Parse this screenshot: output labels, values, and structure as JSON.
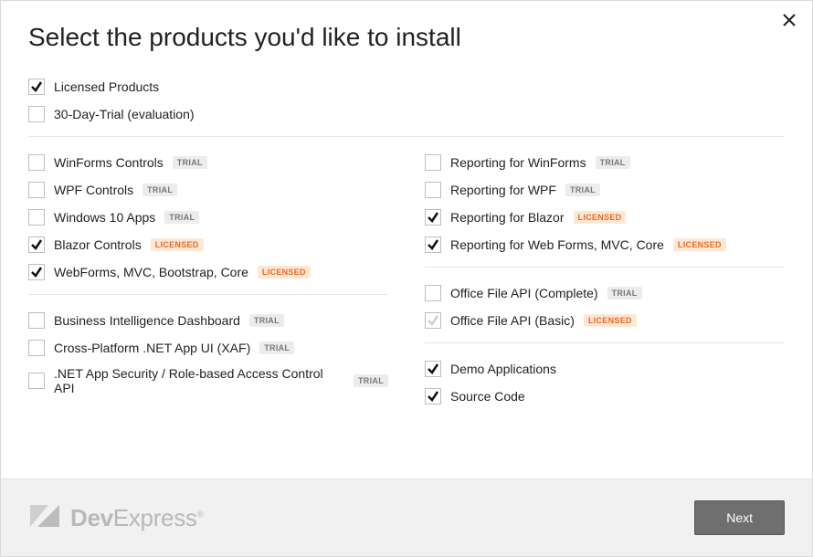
{
  "title": "Select the products you'd like to install",
  "topOptions": [
    {
      "id": "licensed-products",
      "label": "Licensed Products",
      "checked": true
    },
    {
      "id": "trial-30-day",
      "label": "30-Day-Trial (evaluation)",
      "checked": false
    }
  ],
  "badges": {
    "trial": "TRIAL",
    "licensed": "LICENSED"
  },
  "leftGroups": [
    [
      {
        "id": "winforms-controls",
        "label": "WinForms Controls",
        "badge": "trial",
        "checked": false
      },
      {
        "id": "wpf-controls",
        "label": "WPF Controls",
        "badge": "trial",
        "checked": false
      },
      {
        "id": "win10-apps",
        "label": "Windows 10 Apps",
        "badge": "trial",
        "checked": false
      },
      {
        "id": "blazor-controls",
        "label": "Blazor Controls",
        "badge": "licensed",
        "checked": true
      },
      {
        "id": "webforms-mvc",
        "label": "WebForms, MVC, Bootstrap, Core",
        "badge": "licensed",
        "checked": true
      }
    ],
    [
      {
        "id": "bi-dashboard",
        "label": "Business Intelligence Dashboard",
        "badge": "trial",
        "checked": false
      },
      {
        "id": "xaf",
        "label": "Cross-Platform .NET App UI (XAF)",
        "badge": "trial",
        "checked": false
      },
      {
        "id": "net-app-security",
        "label": ".NET App Security / Role-based Access Control API",
        "badge": "trial",
        "checked": false
      }
    ]
  ],
  "rightGroups": [
    [
      {
        "id": "reporting-winforms",
        "label": "Reporting for WinForms",
        "badge": "trial",
        "checked": false
      },
      {
        "id": "reporting-wpf",
        "label": "Reporting for WPF",
        "badge": "trial",
        "checked": false
      },
      {
        "id": "reporting-blazor",
        "label": "Reporting for Blazor",
        "badge": "licensed",
        "checked": true
      },
      {
        "id": "reporting-web",
        "label": "Reporting for Web Forms, MVC, Core",
        "badge": "licensed",
        "checked": true
      }
    ],
    [
      {
        "id": "office-api-complete",
        "label": "Office File API (Complete)",
        "badge": "trial",
        "checked": false
      },
      {
        "id": "office-api-basic",
        "label": "Office File API (Basic)",
        "badge": "licensed",
        "checked": false,
        "indeterminate": true
      }
    ],
    [
      {
        "id": "demo-apps",
        "label": "Demo Applications",
        "badge": null,
        "checked": true
      },
      {
        "id": "source-code",
        "label": "Source Code",
        "badge": null,
        "checked": true
      }
    ]
  ],
  "footer": {
    "brand1": "Dev",
    "brand2": "Express",
    "next": "Next"
  }
}
